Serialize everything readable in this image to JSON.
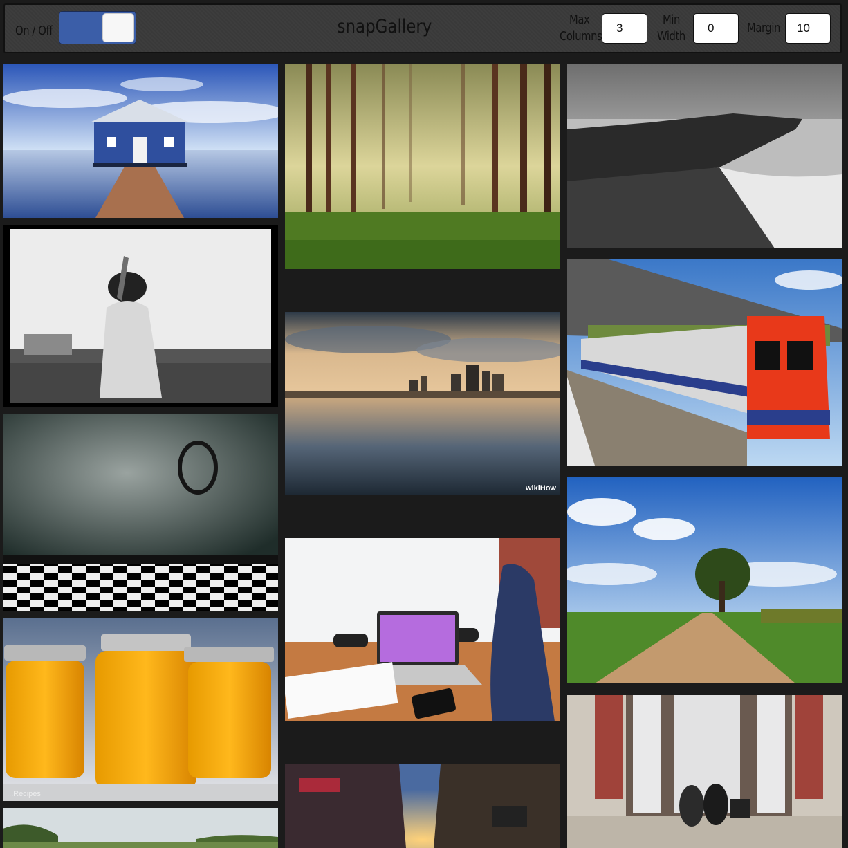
{
  "toolbar": {
    "toggle_label": "On / Off",
    "toggle_state": "on",
    "title": "snapGallery",
    "max_columns_label_1": "Max",
    "max_columns_label_2": "Columns",
    "max_columns_value": "3",
    "min_width_label_1": "Min",
    "min_width_label_2": "Width",
    "min_width_value": "0",
    "margin_label": "Margin",
    "margin_value": "10",
    "accent_color": "#3b5ea8"
  },
  "gallery": {
    "watermarks": {
      "city_reflection": "wikiHow",
      "honey_jars": "...Recipes"
    },
    "photos": [
      "blue-boathouse-pier",
      "woman-beach-crowd-bw",
      "grunge-room-checkered-floor",
      "honey-jars",
      "forest-fog",
      "city-water-reflection",
      "laptop-desk-office",
      "street-sunset",
      "sea-cliffs-bw",
      "london-underground-train",
      "tree-dirt-road",
      "two-women-window-ledge"
    ]
  }
}
